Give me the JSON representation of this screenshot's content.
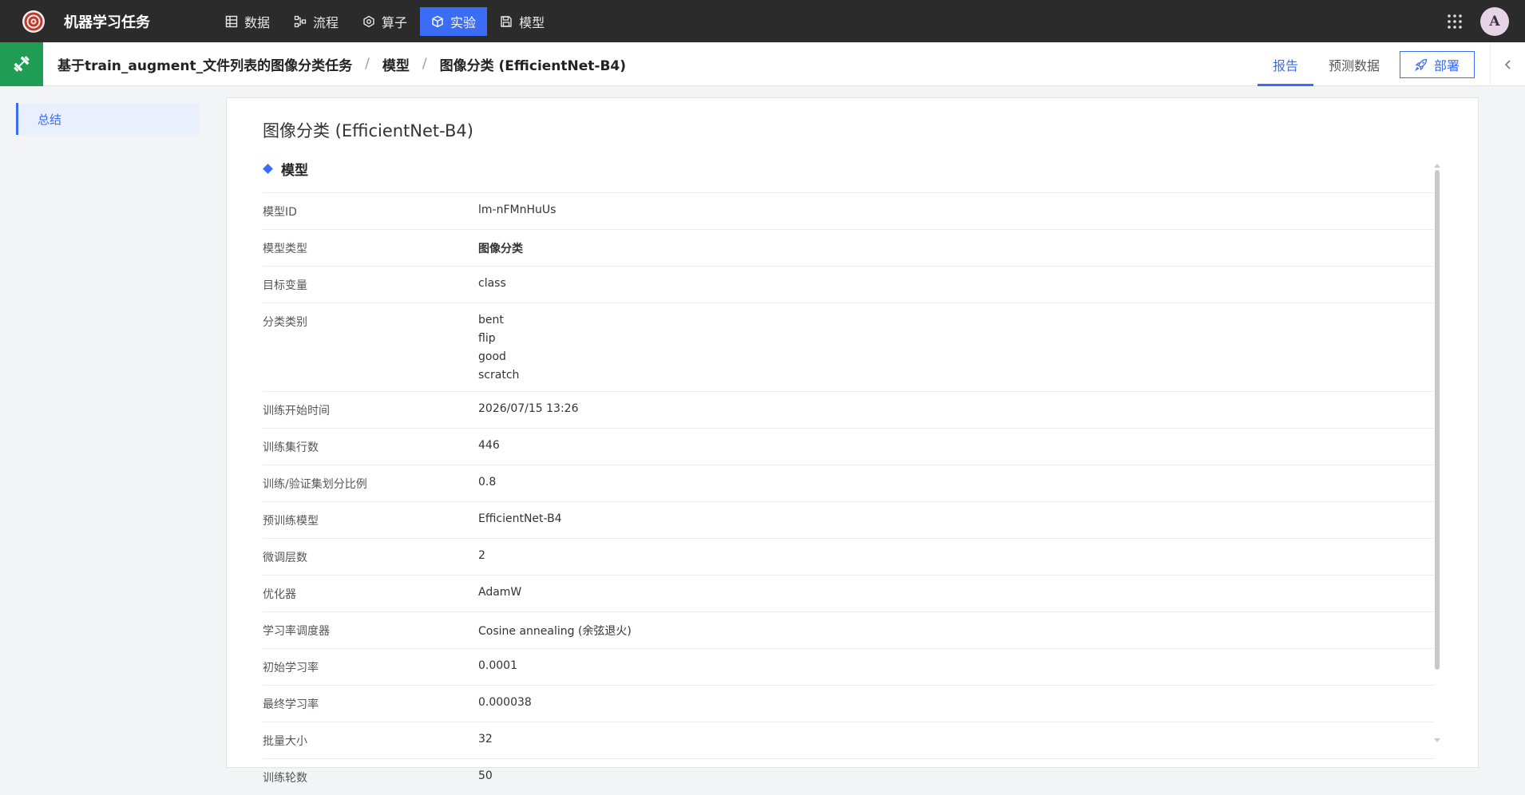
{
  "topbar": {
    "app_title": "机器学习任务",
    "nav": [
      {
        "label": "数据",
        "icon": "table-icon"
      },
      {
        "label": "流程",
        "icon": "flow-icon"
      },
      {
        "label": "算子",
        "icon": "hexagon-icon"
      },
      {
        "label": "实验",
        "icon": "cube-icon",
        "active": true
      },
      {
        "label": "模型",
        "icon": "save-icon"
      }
    ],
    "avatar": "A"
  },
  "subheader": {
    "breadcrumb": [
      "基于train_augment_文件列表的图像分类任务",
      "模型",
      "图像分类 (EfficientNet-B4)"
    ],
    "separator": "/",
    "tabs": [
      "报告",
      "预测数据"
    ],
    "active_tab": "报告",
    "deploy_label": "部署"
  },
  "sidebar": {
    "items": [
      {
        "label": "总结",
        "active": true
      }
    ]
  },
  "panel": {
    "title": "图像分类 (EfficientNet-B4)",
    "section": "模型",
    "rows": [
      {
        "label": "模型ID",
        "value": "lm-nFMnHuUs"
      },
      {
        "label": "模型类型",
        "value": "图像分类"
      },
      {
        "label": "目标变量",
        "value": "class"
      },
      {
        "label": "分类类别",
        "values": [
          "bent",
          "flip",
          "good",
          "scratch"
        ]
      },
      {
        "label": "训练开始时间",
        "value": "2026/07/15 13:26"
      },
      {
        "label": "训练集行数",
        "value": "446"
      },
      {
        "label": "训练/验证集划分比例",
        "value": "0.8"
      },
      {
        "label": "预训练模型",
        "value": "EfficientNet-B4"
      },
      {
        "label": "微调层数",
        "value": "2"
      },
      {
        "label": "优化器",
        "value": "AdamW"
      },
      {
        "label": "学习率调度器",
        "value": "Cosine annealing (余弦退火)"
      },
      {
        "label": "初始学习率",
        "value": "0.0001"
      },
      {
        "label": "最终学习率",
        "value": "0.000038"
      },
      {
        "label": "批量大小",
        "value": "32"
      },
      {
        "label": "训练轮数",
        "value": "50"
      }
    ]
  },
  "colors": {
    "accent": "#3b6cf5",
    "topbar": "#2b2b2b",
    "experiment_green": "#1f9d55"
  }
}
